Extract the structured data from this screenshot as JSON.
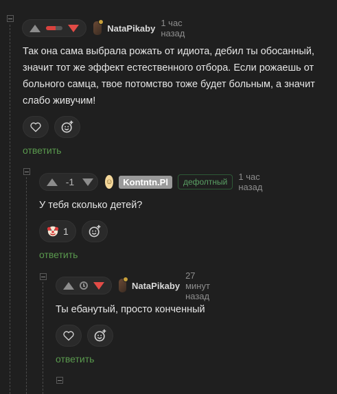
{
  "comments": [
    {
      "author": "NataPikaby",
      "time": "1 час назад",
      "rating_negative_fraction": 0.6,
      "text": "Так она сама выбрала рожать от идиота, дебил ты обосанный, значит тот же эффект естественного отбора. Если рожаешь от больного самца, твое потомство тоже будет больным, а значит слабо живучим!",
      "reply_label": "ответить"
    },
    {
      "author": "Kontntn.Pl",
      "tag": "дефолтный",
      "time": "1 час назад",
      "score": "-1",
      "text": "У тебя сколько детей?",
      "reaction_count": "1",
      "reply_label": "ответить"
    },
    {
      "author": "NataPikaby",
      "time": "27 минут назад",
      "text": "Ты ебанутый, просто конченный",
      "reply_label": "ответить"
    }
  ],
  "icons": {
    "upvote": "triangle-up-icon",
    "downvote": "triangle-down-icon",
    "like": "heart-icon",
    "react": "smiley-plus-icon",
    "pending": "clock-icon",
    "reaction": "clown-face-icon"
  },
  "colors": {
    "background": "#1f1f1f",
    "downvote_active": "#e24b46",
    "reply_link": "#5a9a4e",
    "tag": "#5aa064"
  }
}
